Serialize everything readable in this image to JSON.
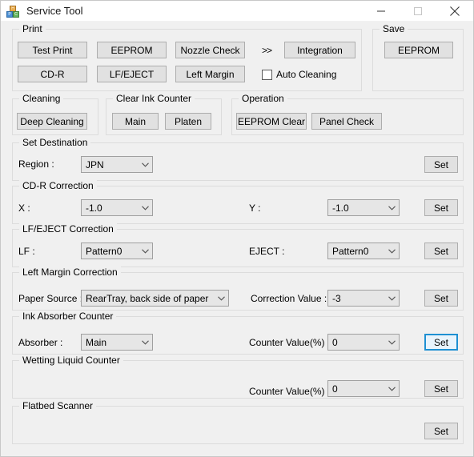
{
  "window": {
    "title": "Service Tool",
    "icon": "blocks-icon",
    "controls": {
      "minimize": "minimize-icon",
      "maximize": "maximize-icon",
      "close": "close-icon"
    }
  },
  "groups": {
    "print": {
      "legend": "Print",
      "buttons": [
        "Test Print",
        "EEPROM",
        "Nozzle Check",
        "Integration",
        "CD-R",
        "LF/EJECT",
        "Left Margin"
      ],
      "arrows": ">>",
      "auto_cleaning_label": "Auto Cleaning",
      "auto_cleaning_checked": false
    },
    "save": {
      "legend": "Save",
      "button": "EEPROM"
    },
    "cleaning": {
      "legend": "Cleaning",
      "button": "Deep Cleaning"
    },
    "clear_ink_counter": {
      "legend": "Clear Ink Counter",
      "buttons": [
        "Main",
        "Platen"
      ]
    },
    "operation": {
      "legend": "Operation",
      "buttons": [
        "EEPROM Clear",
        "Panel Check"
      ]
    },
    "set_destination": {
      "legend": "Set Destination",
      "region_label": "Region :",
      "region_value": "JPN",
      "set_label": "Set"
    },
    "cdr_correction": {
      "legend": "CD-R Correction",
      "x_label": "X :",
      "x_value": "-1.0",
      "y_label": "Y :",
      "y_value": "-1.0",
      "set_label": "Set"
    },
    "lf_eject_correction": {
      "legend": "LF/EJECT Correction",
      "lf_label": "LF :",
      "lf_value": "Pattern0",
      "eject_label": "EJECT :",
      "eject_value": "Pattern0",
      "set_label": "Set"
    },
    "left_margin_correction": {
      "legend": "Left Margin Correction",
      "paper_source_label": "Paper Source :",
      "paper_source_value": "RearTray, back side of paper",
      "correction_label": "Correction Value :",
      "correction_value": "-3",
      "set_label": "Set"
    },
    "ink_absorber_counter": {
      "legend": "Ink Absorber Counter",
      "absorber_label": "Absorber :",
      "absorber_value": "Main",
      "counter_label": "Counter Value(%) :",
      "counter_value": "0",
      "set_label": "Set",
      "set_focused": true
    },
    "wetting_liquid_counter": {
      "legend": "Wetting Liquid Counter",
      "counter_label": "Counter Value(%) :",
      "counter_value": "0",
      "set_label": "Set"
    },
    "flatbed_scanner": {
      "legend": "Flatbed Scanner",
      "set_label": "Set"
    }
  },
  "colors": {
    "window_bg": "#f0f0f0",
    "titlebar_bg": "#ffffff",
    "button_bg": "#e1e1e1",
    "button_border": "#adadad",
    "combo_bg": "#e6e6e6",
    "group_border": "#dcdcdc",
    "focus_blue": "#1e90d2"
  }
}
